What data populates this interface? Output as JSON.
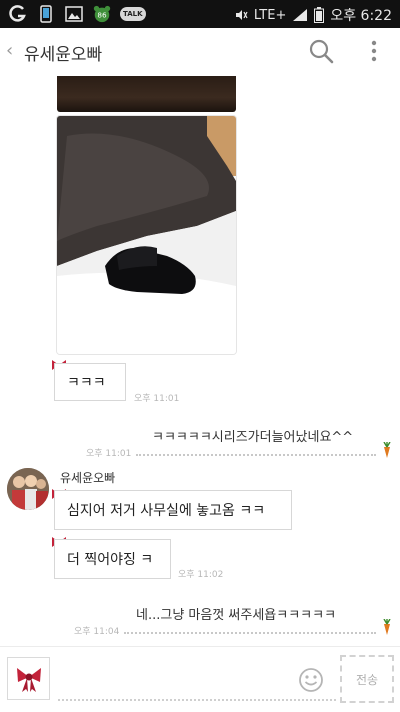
{
  "status_bar": {
    "carrier_icon": "carrier-g-icon",
    "network_label": "LTE+",
    "time": "오후 6:22",
    "badge_count": "86",
    "talk_label": "TALK"
  },
  "header": {
    "title": "유세윤오빠"
  },
  "messages": {
    "m1_text": "ㅋㅋㅋ",
    "m1_time": "오후 11:01",
    "m2_text": "ㅋㅋㅋㅋㅋ시리즈가더늘어났네요^^",
    "m2_time": "오후 11:01",
    "sender_name": "유세윤오빠",
    "m3_text": "심지어 저거 사무실에 놓고옴 ㅋㅋ",
    "m4_text": "더 찍어야징 ㅋ",
    "m4_time": "오후 11:02",
    "m5_text": "네...그냥 마음껏 써주세욥ㅋㅋㅋㅋㅋ",
    "m5_time": "오후 11:04"
  },
  "input_bar": {
    "placeholder": "",
    "send_label": "전송"
  },
  "colors": {
    "statusbar": "#111111",
    "ribbon": "#c3223a",
    "carrot": "#e07a1f",
    "bubble_border": "#d7d7d7"
  }
}
